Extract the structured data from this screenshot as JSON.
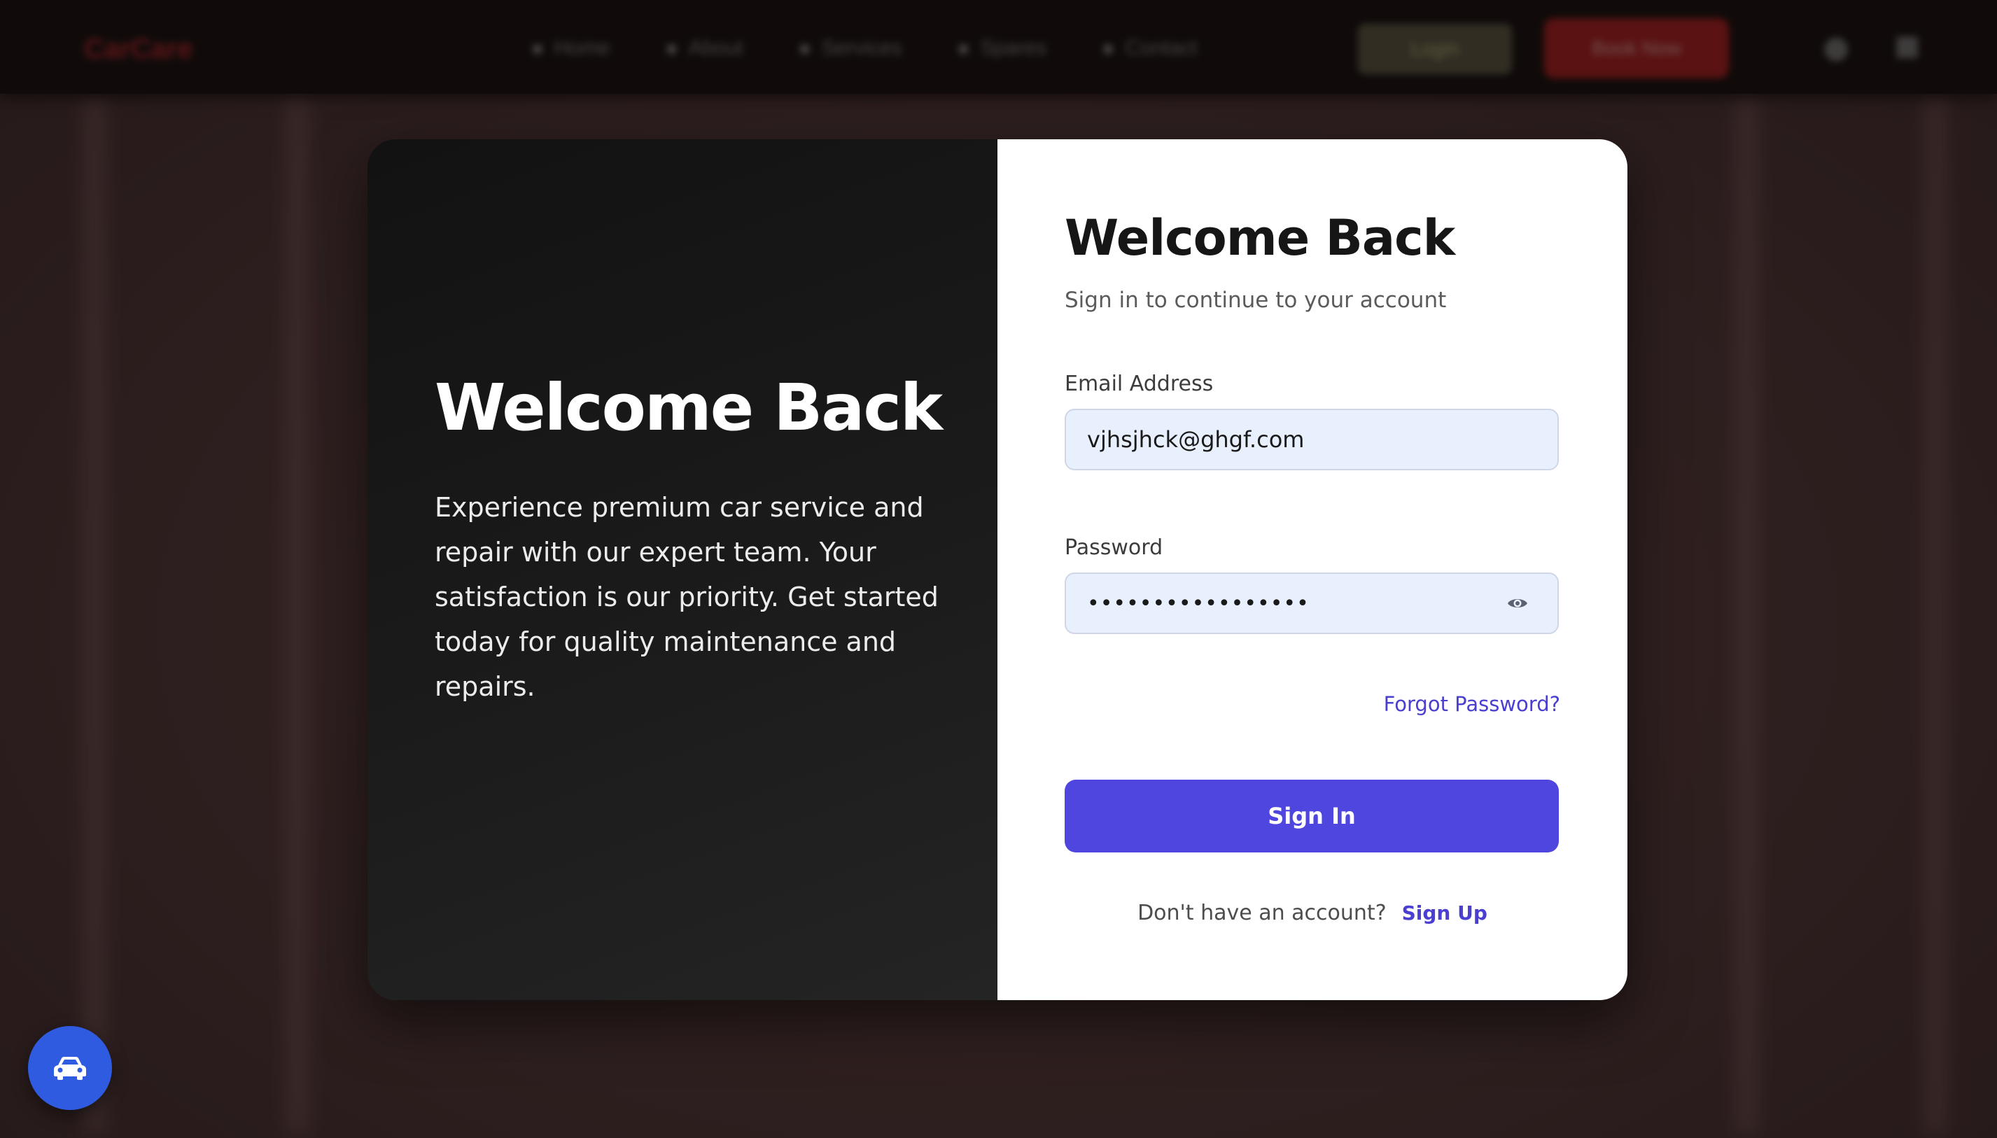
{
  "navbar": {
    "logo": "CarCare",
    "links": [
      "Home",
      "About",
      "Services",
      "Spares",
      "Contact"
    ],
    "login_label": "Login",
    "book_label": "Book Now",
    "user_icon": "user-icon",
    "cart_icon": "cart-icon"
  },
  "modal": {
    "left": {
      "title": "Welcome Back",
      "description": "Experience premium car service and repair with our expert team. Your satisfaction is our priority. Get started today for quality maintenance and repairs."
    },
    "right": {
      "title": "Welcome Back",
      "subtitle": "Sign in to continue to your account",
      "email_label": "Email Address",
      "email_value": "vjhsjhck@ghgf.com",
      "password_label": "Password",
      "password_masked": "•••••••••••••••••",
      "password_toggle_icon": "eye-icon",
      "forgot_password": "Forgot Password?",
      "sign_in": "Sign In",
      "no_account": "Don't have an account?",
      "sign_up": "Sign Up"
    }
  },
  "fab": {
    "icon": "car-icon"
  },
  "colors": {
    "accent": "#4f46e0",
    "link": "#4a3fd0",
    "input_bg": "#e8f0fe",
    "fab": "#2f5be0",
    "brand_red": "#b81e1e"
  }
}
